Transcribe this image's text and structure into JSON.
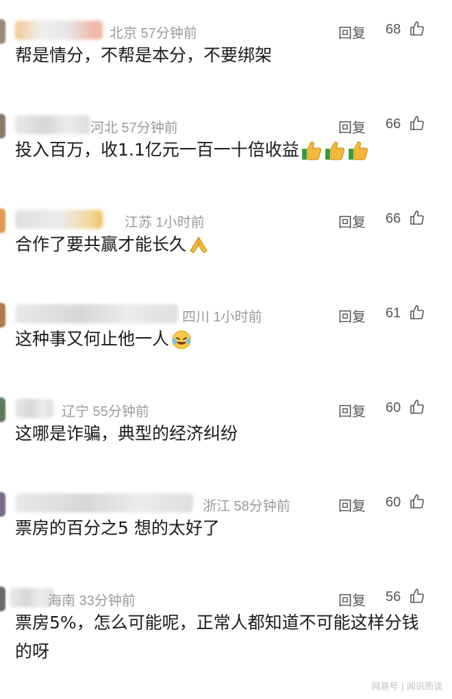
{
  "reply_label": "回复",
  "comments": [
    {
      "meta": "北京 57分钟前",
      "likes": "68",
      "text": "帮是情分，不帮是本分，不要绑架"
    },
    {
      "meta": "河北 57分钟前",
      "likes": "66",
      "text": "投入百万，收1.1亿元一百一十倍收益"
    },
    {
      "meta": "江苏 1小时前",
      "likes": "66",
      "text": "合作了要共赢才能长久"
    },
    {
      "meta": "四川 1小时前",
      "likes": "61",
      "text": "这种事又何止他一人"
    },
    {
      "meta": "辽宁 55分钟前",
      "likes": "60",
      "text": "这哪是诈骗，典型的经济纠纷"
    },
    {
      "meta": "浙江 58分钟前",
      "likes": "60",
      "text": "票房的百分之5 想的太好了"
    },
    {
      "meta": "海南 33分钟前",
      "likes": "56",
      "text": "票房5%，怎么可能呢，正常人都知道不可能这样分钱的呀"
    }
  ],
  "watermark": "网易号 | 闻讯而谈"
}
